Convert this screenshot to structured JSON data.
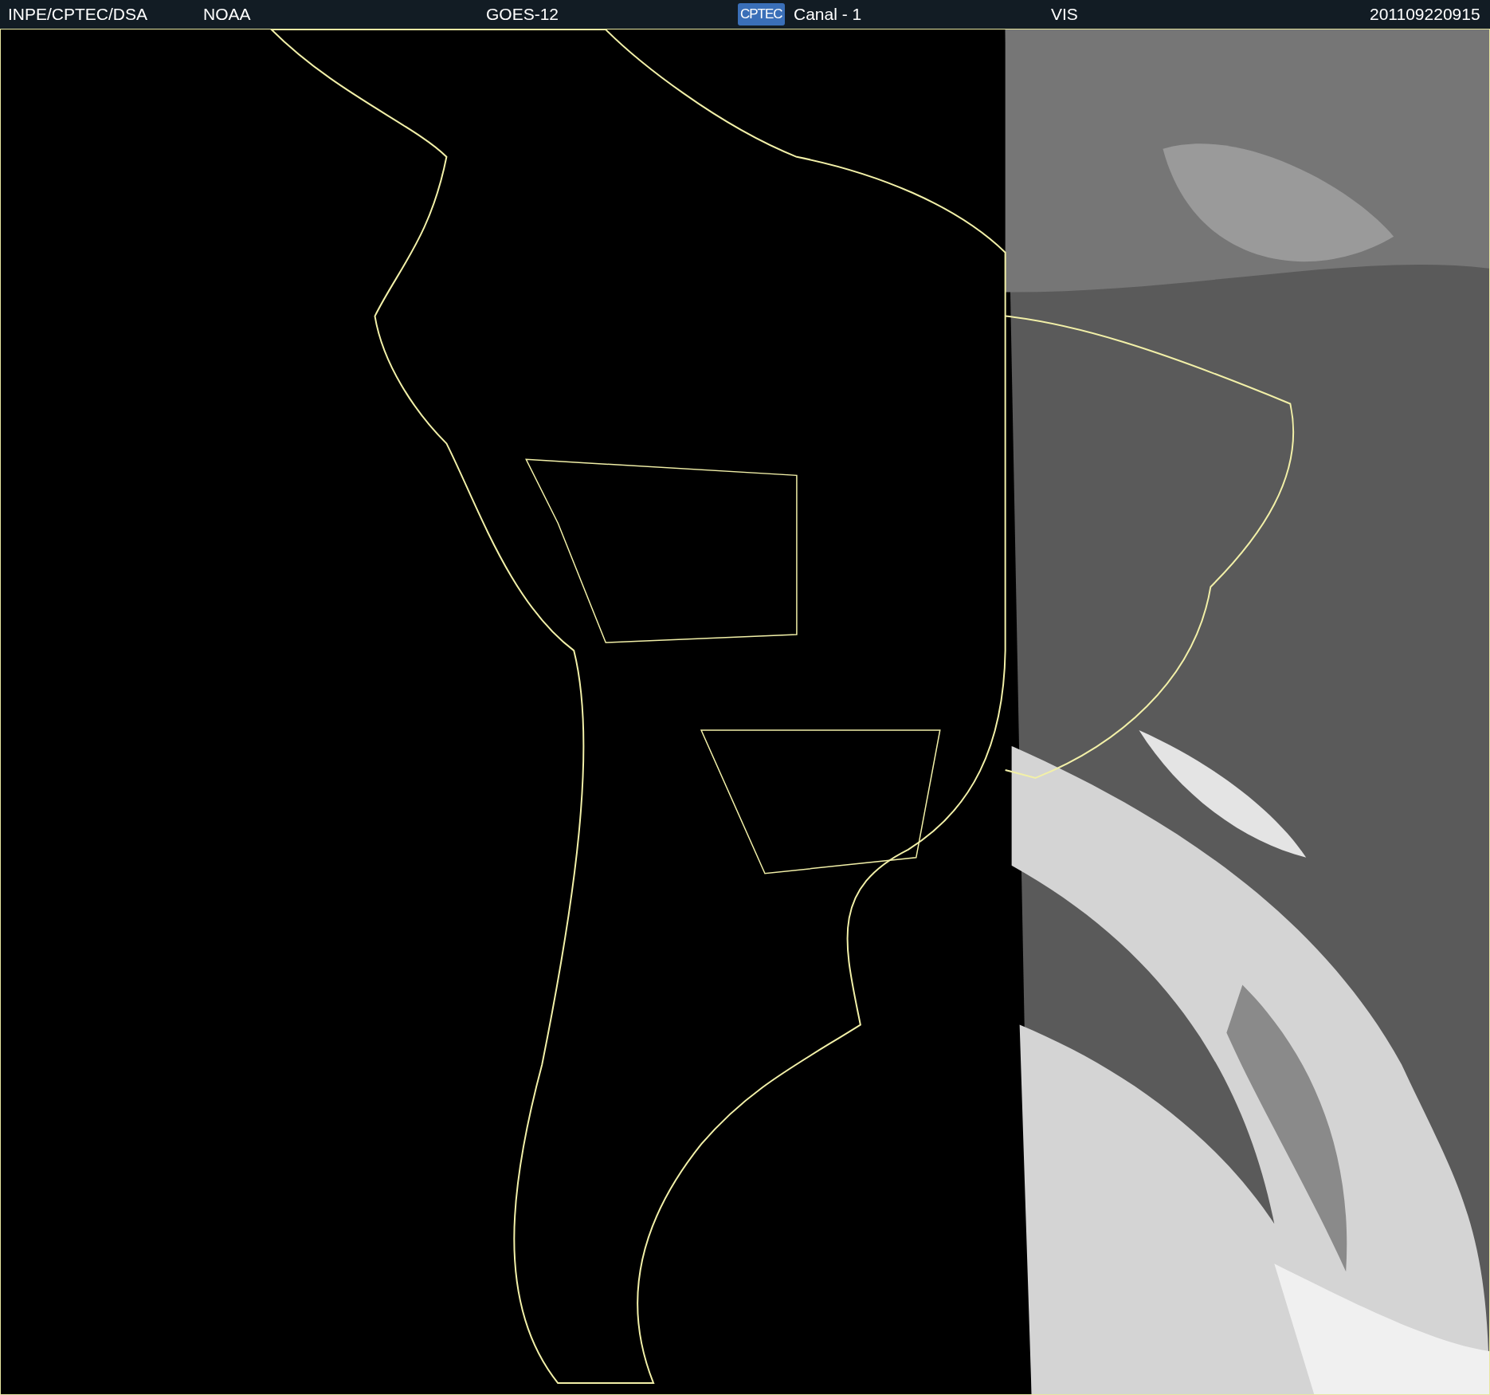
{
  "header": {
    "source": "INPE/CPTEC/DSA",
    "agency": "NOAA",
    "satellite": "GOES-12",
    "logo": "CPTEC",
    "channel": "Canal - 1",
    "band": "VIS",
    "timestamp": "201109220915"
  }
}
